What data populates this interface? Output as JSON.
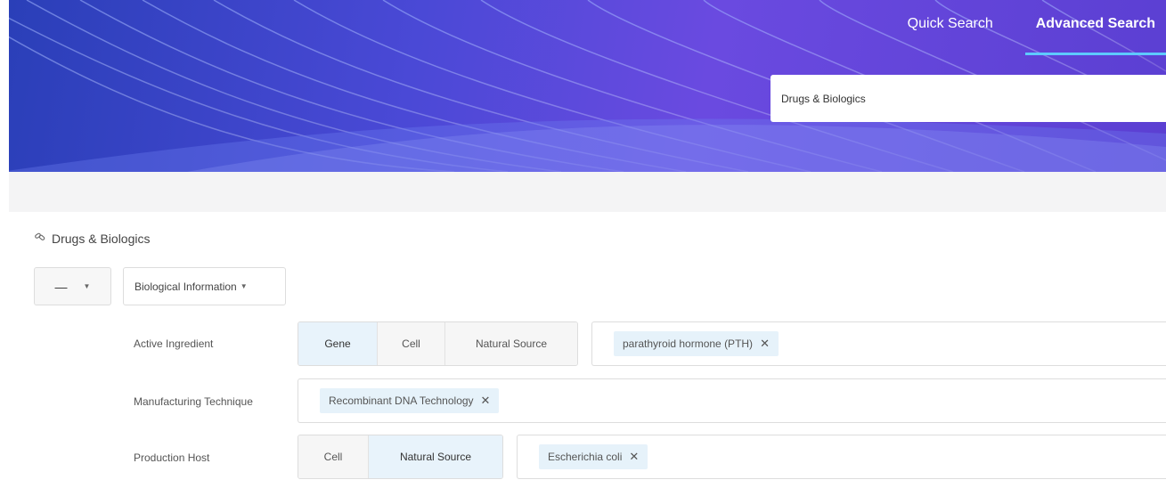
{
  "nav": {
    "quick_search": "Quick Search",
    "advanced_search": "Advanced Search"
  },
  "scope": {
    "selected": "Drugs & Biologics"
  },
  "section": {
    "title": "Drugs & Biologics",
    "icon": "pill-capsules-icon"
  },
  "filters": {
    "operator": "—",
    "category": "Biological Information",
    "rows": [
      {
        "label": "Active Ingredient",
        "options": [
          "Gene",
          "Cell",
          "Natural Source"
        ],
        "selected": "Gene",
        "chips": [
          "parathyroid hormone (PTH)"
        ]
      },
      {
        "label": "Manufacturing Technique",
        "options": [],
        "chips": [
          "Recombinant DNA Technology"
        ]
      },
      {
        "label": "Production Host",
        "options": [
          "Cell",
          "Natural Source"
        ],
        "selected": "Natural Source",
        "chips": [
          "Escherichia coli"
        ]
      }
    ]
  },
  "colors": {
    "hero_primary": "#4a49d6",
    "active_tab_underline": "#5ec9ff",
    "chip_background": "#e6f2fa",
    "selected_segment": "#e8f3fb"
  }
}
